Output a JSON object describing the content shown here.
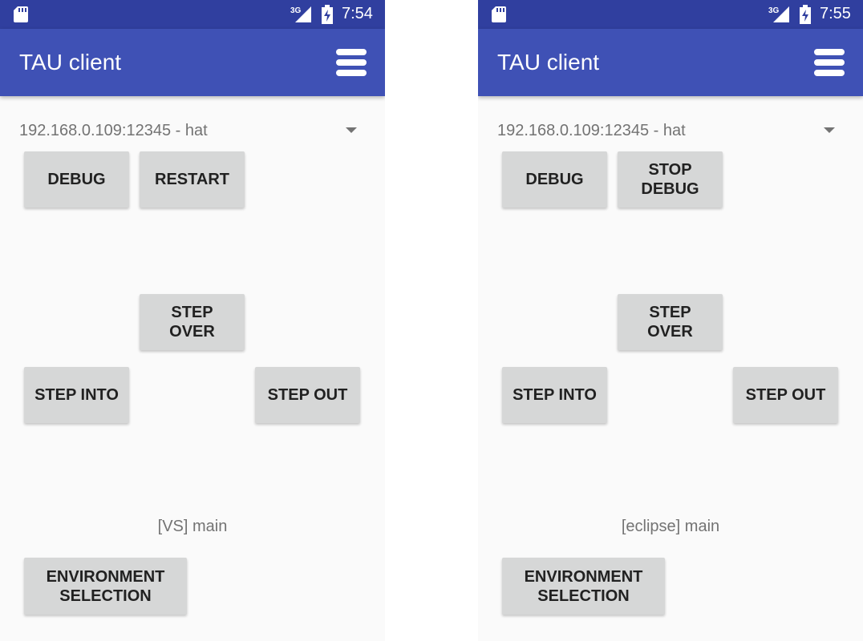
{
  "screens": [
    {
      "status_time": "7:54",
      "network_type": "3G",
      "app_title": "TAU client",
      "connection": "192.168.0.109:12345 - hat",
      "buttons": {
        "debug": [
          "DEBUG"
        ],
        "secondary": [
          "RESTART"
        ],
        "step_over": [
          "STEP",
          "OVER"
        ],
        "step_into": [
          "STEP INTO"
        ],
        "step_out": [
          "STEP OUT"
        ],
        "environment_selection": [
          "ENVIRONMENT",
          "SELECTION"
        ]
      },
      "environment_label": "[VS] main"
    },
    {
      "status_time": "7:55",
      "network_type": "3G",
      "app_title": "TAU client",
      "connection": "192.168.0.109:12345 - hat",
      "buttons": {
        "debug": [
          "DEBUG"
        ],
        "secondary": [
          "STOP",
          "DEBUG"
        ],
        "step_over": [
          "STEP",
          "OVER"
        ],
        "step_into": [
          "STEP INTO"
        ],
        "step_out": [
          "STEP OUT"
        ],
        "environment_selection": [
          "ENVIRONMENT",
          "SELECTION"
        ]
      },
      "environment_label": "[eclipse] main"
    }
  ],
  "icons": {
    "status_bar": [
      "sd-card-icon",
      "signal-3g-icon",
      "battery-charging-icon"
    ],
    "app_bar": "hamburger-menu-icon",
    "spinner": "dropdown-arrow-icon"
  },
  "colors": {
    "status_bar": "#303f9f",
    "app_bar": "#3f51b5",
    "background": "#fafafa",
    "button": "#d6d7d7",
    "button_text": "#212121",
    "secondary_text": "#737373"
  }
}
